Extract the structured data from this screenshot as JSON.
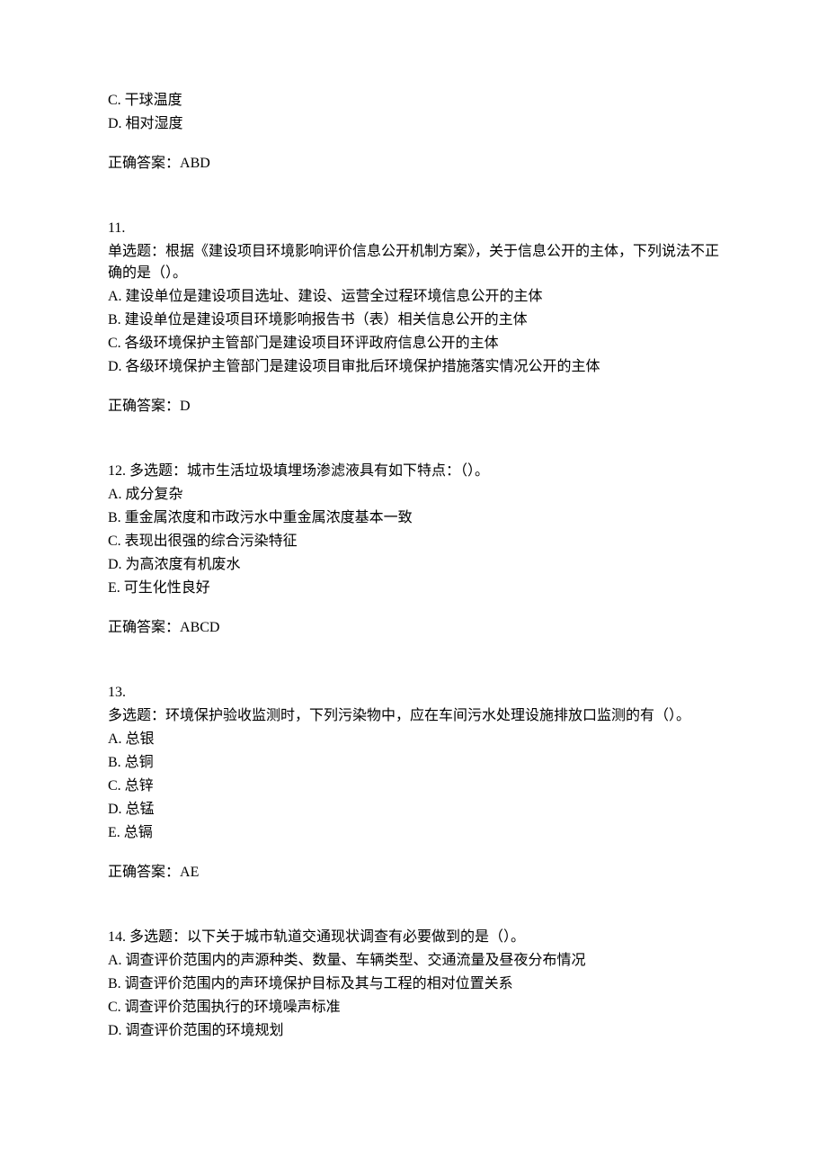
{
  "q10": {
    "optC": "C. 干球温度",
    "optD": "D. 相对湿度",
    "answerLabel": "正确答案：",
    "answerValue": "ABD"
  },
  "q11": {
    "num": "11.",
    "stem": "单选题：根据《建设项目环境影响评价信息公开机制方案》，关于信息公开的主体，下列说法不正确的是（）。",
    "optA": "A. 建设单位是建设项目选址、建设、运营全过程环境信息公开的主体",
    "optB": "B. 建设单位是建设项目环境影响报告书（表）相关信息公开的主体",
    "optC": "C. 各级环境保护主管部门是建设项目环评政府信息公开的主体",
    "optD": "D. 各级环境保护主管部门是建设项目审批后环境保护措施落实情况公开的主体",
    "answerLabel": "正确答案：",
    "answerValue": "D"
  },
  "q12": {
    "num": "12.  ",
    "stem": "多选题：城市生活垃圾填埋场渗滤液具有如下特点：（）。",
    "optA": "A. 成分复杂",
    "optB": "B. 重金属浓度和市政污水中重金属浓度基本一致",
    "optC": "C. 表现出很强的综合污染特征",
    "optD": "D. 为高浓度有机废水",
    "optE": "E. 可生化性良好",
    "answerLabel": "正确答案：",
    "answerValue": "ABCD"
  },
  "q13": {
    "num": "13.",
    "stem": "多选题：环境保护验收监测时，下列污染物中，应在车间污水处理设施排放口监测的有（）。",
    "optA": "A. 总银",
    "optB": "B. 总铜",
    "optC": "C. 总锌",
    "optD": "D. 总锰",
    "optE": "E. 总镉",
    "answerLabel": "正确答案：",
    "answerValue": "AE"
  },
  "q14": {
    "num": "14.  ",
    "stem": "多选题：以下关于城市轨道交通现状调查有必要做到的是（）。",
    "optA": "A. 调查评价范围内的声源种类、数量、车辆类型、交通流量及昼夜分布情况",
    "optB": "B. 调查评价范围内的声环境保护目标及其与工程的相对位置关系",
    "optC": "C. 调查评价范围执行的环境噪声标准",
    "optD": "D. 调查评价范围的环境规划"
  }
}
